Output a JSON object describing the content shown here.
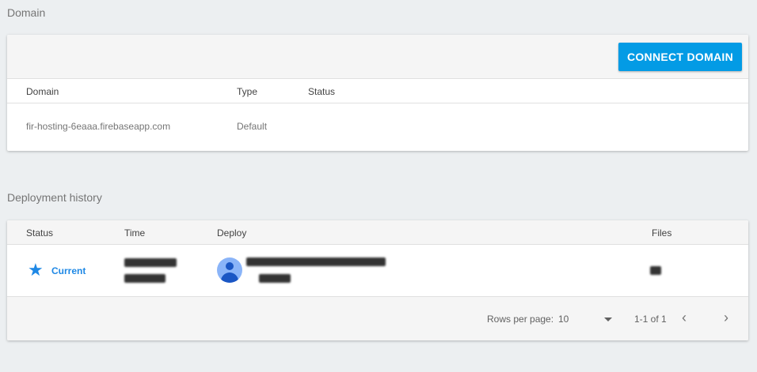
{
  "domain_section": {
    "title": "Domain",
    "connect_button": "CONNECT DOMAIN",
    "columns": {
      "domain": "Domain",
      "type": "Type",
      "status": "Status"
    },
    "rows": [
      {
        "domain": "fir-hosting-6eaaa.firebaseapp.com",
        "type": "Default",
        "status": ""
      }
    ]
  },
  "deployment_section": {
    "title": "Deployment history",
    "columns": {
      "status": "Status",
      "time": "Time",
      "deploy": "Deploy",
      "files": "Files"
    },
    "rows": [
      {
        "status": "Current",
        "status_icon": "star-icon"
      }
    ],
    "pagination": {
      "rows_per_page_label": "Rows per page:",
      "rows_per_page_value": "10",
      "range": "1-1 of 1"
    }
  },
  "colors": {
    "accent": "#039be5",
    "status_current": "#1e88e5",
    "background": "#eceff1"
  }
}
